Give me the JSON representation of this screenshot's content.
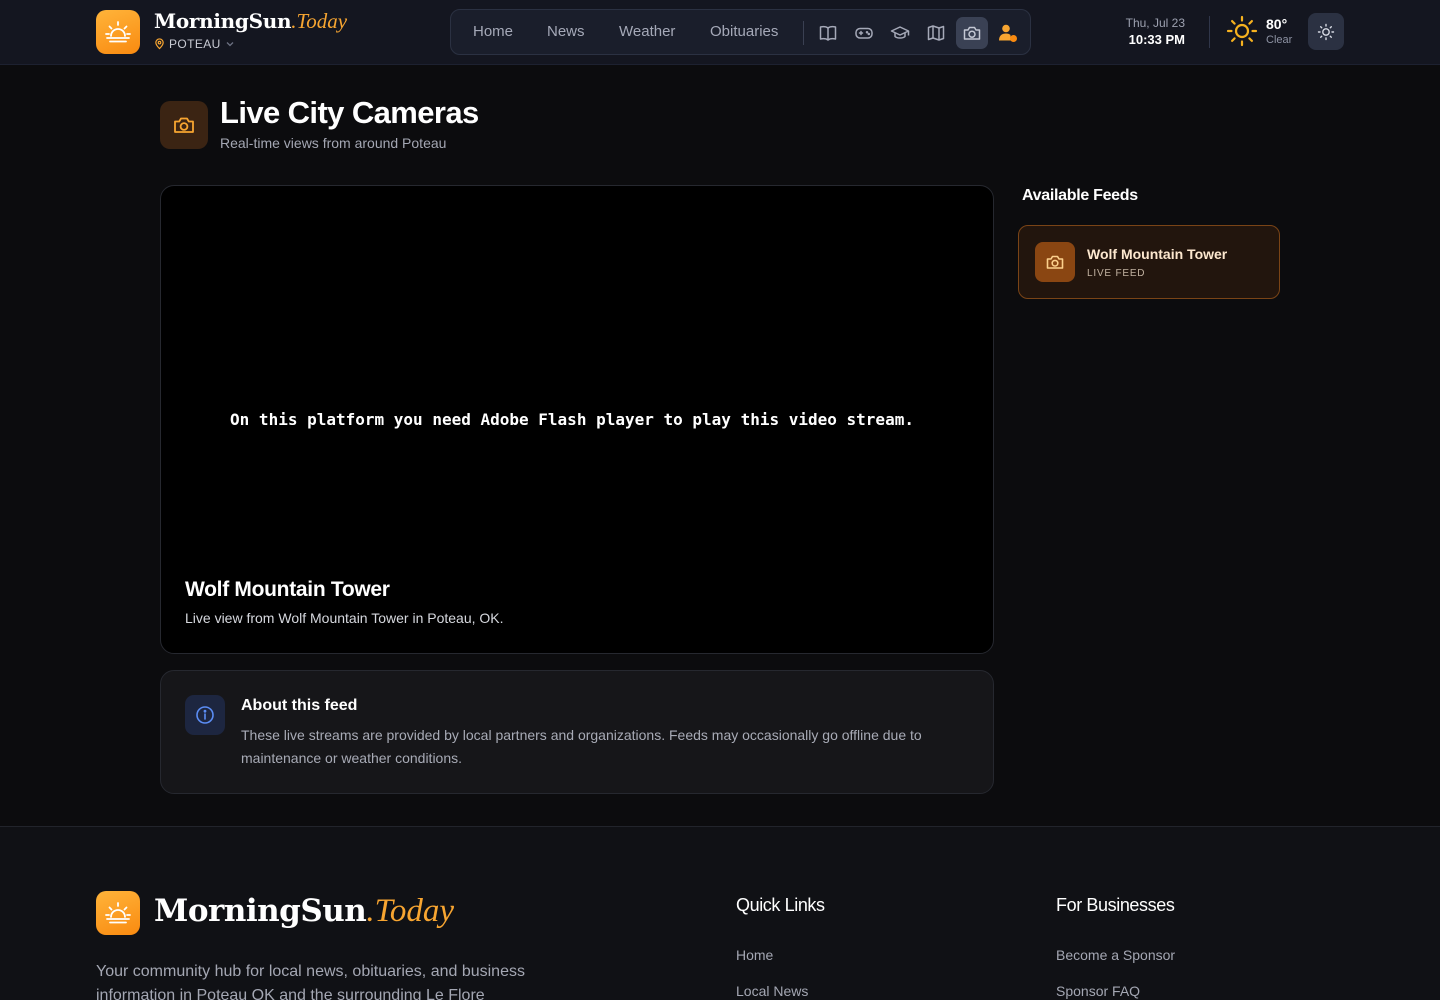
{
  "header": {
    "brand_main": "MorningSun",
    "brand_suffix": ".Today",
    "location": "POTEAU",
    "nav": {
      "links": [
        "Home",
        "News",
        "Weather",
        "Obituaries"
      ],
      "icons": [
        "book-icon",
        "gamepad-icon",
        "graduation-cap-icon",
        "map-icon",
        "camera-icon",
        "user-alert-icon"
      ],
      "active_icon": "camera-icon"
    },
    "date": "Thu, Jul 23",
    "time": "10:33 PM",
    "temperature": "80°",
    "condition": "Clear"
  },
  "page": {
    "title": "Live City Cameras",
    "subtitle": "Real-time views from around Poteau"
  },
  "player": {
    "message": "On this platform you need Adobe Flash player to play this video stream.",
    "camera_name": "Wolf Mountain Tower",
    "camera_description": "Live view from Wolf Mountain Tower in Poteau, OK."
  },
  "about": {
    "title": "About this feed",
    "text": "These live streams are provided by local partners and organizations. Feeds may occasionally go offline due to maintenance or weather conditions."
  },
  "sidebar": {
    "heading": "Available Feeds",
    "feeds": [
      {
        "name": "Wolf Mountain Tower",
        "status": "LIVE FEED"
      }
    ]
  },
  "footer": {
    "brand_main": "MorningSun",
    "brand_suffix": ".Today",
    "description": "Your community hub for local news, obituaries, and business information in Poteau OK and the surrounding Le Flore",
    "quick_links": {
      "heading": "Quick Links",
      "links": [
        "Home",
        "Local News"
      ]
    },
    "for_businesses": {
      "heading": "For Businesses",
      "links": [
        "Become a Sponsor",
        "Sponsor FAQ"
      ]
    }
  },
  "colors": {
    "accent": "#f7a531",
    "background": "#0c0c0e",
    "header_bg": "#141620"
  }
}
